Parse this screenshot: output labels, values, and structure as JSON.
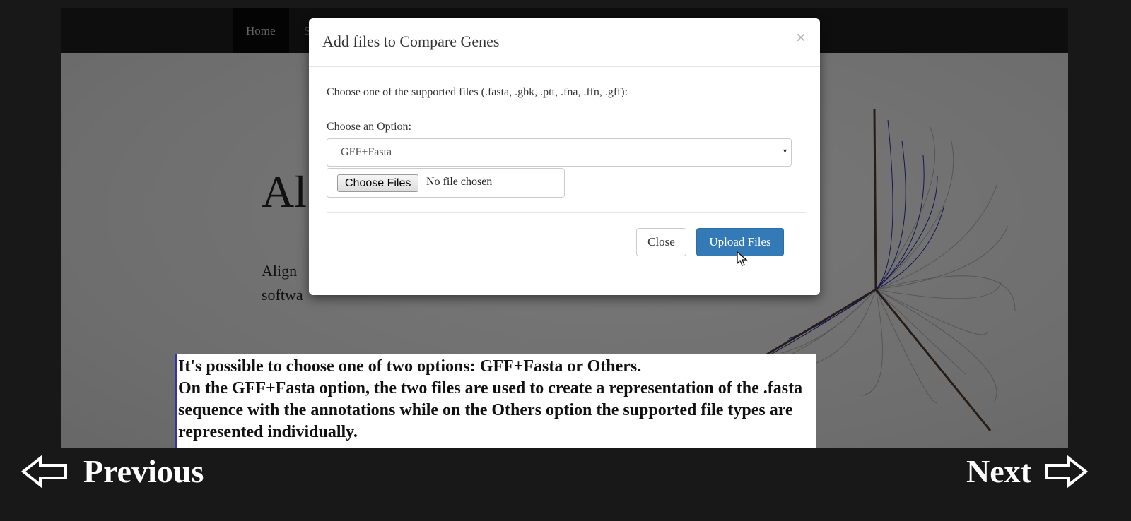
{
  "navbar": {
    "items": [
      {
        "label": "Home"
      },
      {
        "label": "S"
      }
    ]
  },
  "hero": {
    "title": "Al                                                        e",
    "text_line1": "Align ",
    "text_line2": "softwa"
  },
  "modal": {
    "title": "Add files to Compare Genes",
    "close_symbol": "×",
    "description": "Choose one of the supported files (.fasta, .gbk, .ptt, .fna, .ffn, .gff):",
    "option_label": "Choose an Option:",
    "select": {
      "value": "GFF+Fasta",
      "caret": "▾"
    },
    "file_input": {
      "button_label": "Choose Files",
      "status": "No file chosen"
    },
    "buttons": {
      "close": "Close",
      "upload": "Upload Files"
    }
  },
  "caption": {
    "line1": "It's possible to choose one of two options: GFF+Fasta or Others.",
    "line2": "On the GFF+Fasta option, the two files are used to create a representation of the .fasta sequence with the annotations while on the Others option the supported file types are represented individually."
  },
  "footer": {
    "previous": "Previous",
    "next": "Next"
  },
  "colors": {
    "primary_button": "#337ab7",
    "caption_border": "#3333aa",
    "page_background": "#181818"
  }
}
